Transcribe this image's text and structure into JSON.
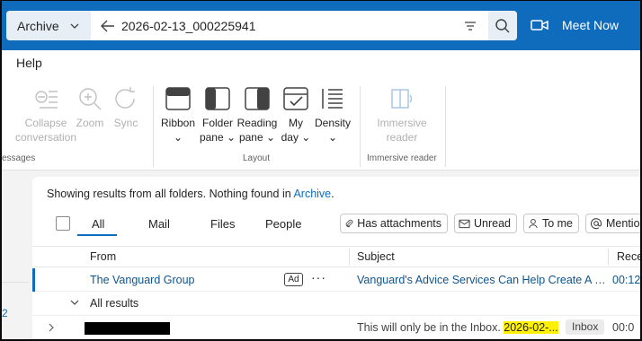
{
  "search": {
    "scope": "Archive",
    "query": "2026-02-13_000225941"
  },
  "meet_now": "Meet Now",
  "menu": {
    "help": "Help"
  },
  "ribbon": {
    "collapse": {
      "line1": "Collapse",
      "line2": "conversation"
    },
    "zoom": "Zoom",
    "sync": "Sync",
    "messages_group_partial": "essages",
    "ribbon": {
      "line1": "Ribbon",
      "line2": "⌄"
    },
    "folder_pane": {
      "line1": "Folder",
      "line2": "pane ⌄"
    },
    "reading_pane": {
      "line1": "Reading",
      "line2": "pane ⌄"
    },
    "my_day": {
      "line1": "My",
      "line2": "day ⌄"
    },
    "density": {
      "line1": "Density",
      "line2": "⌄"
    },
    "layout_group": "Layout",
    "immersive": {
      "line1": "Immersive",
      "line2": "reader"
    },
    "immersive_group": "Immersive reader"
  },
  "results": {
    "info_prefix": "Showing results from all folders. Nothing found in ",
    "info_folder": "Archive",
    "info_suffix": "."
  },
  "tabs": [
    "All",
    "Mail",
    "Files",
    "People"
  ],
  "filters": {
    "attachments": "Has attachments",
    "unread": "Unread",
    "to_me": "To me",
    "mentions": "Mentio"
  },
  "columns": {
    "from": "From",
    "subject": "Subject",
    "received": "Recei"
  },
  "ad_row": {
    "from": "The Vanguard Group",
    "ad_tag": "Ad",
    "more": "···",
    "subject": "Vanguard's Advice Services Can Help Create A Custom Plan For You",
    "time": "00:12"
  },
  "group": {
    "label": "All results"
  },
  "result_row": {
    "subject_prefix": "This will only be in the Inbox. ",
    "subject_highlight": "2026-02-...",
    "folder_badge": "Inbox",
    "time": "00:0"
  },
  "left_count": "2",
  "colors": {
    "brand": "#0f6cbd",
    "highlight": "#fff100"
  }
}
